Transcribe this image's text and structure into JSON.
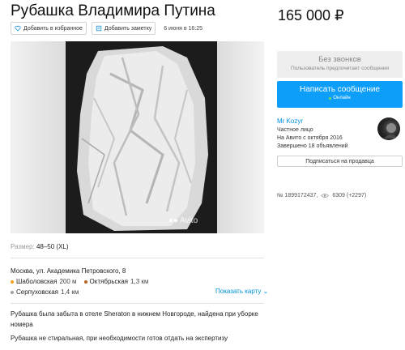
{
  "listing": {
    "title": "Рубашка Владимира Путина",
    "price": "165 000 ₽"
  },
  "actions": {
    "favorite_label": "Добавить в избранное",
    "note_label": "Добавить заметку",
    "posted": "6 июня в 16:25"
  },
  "gallery": {
    "watermark": "Avito"
  },
  "params": {
    "size_label": "Размер:",
    "size_value": "48–50 (XL)"
  },
  "location": {
    "address": "Москва, ул. Академика Петровского, 8",
    "metro": [
      {
        "station": "Шаболовская",
        "distance": "200 м",
        "color": "#f7a21b"
      },
      {
        "station": "Октябрьская",
        "distance": "1,3 км",
        "color": "#b5651d"
      },
      {
        "station": "Серпуховская",
        "distance": "1,4 км",
        "color": "#9aa3a8"
      }
    ],
    "show_map": "Показать карту"
  },
  "description": {
    "lines": [
      "Рубашка была забыта в отеле Sheraton в нижнем Новгороде, найдена при уборке",
      "номера",
      "Рубашка не стиральная, при необходимости готов отдать на экспертизу"
    ]
  },
  "contact": {
    "no_calls_title": "Без звонков",
    "no_calls_sub": "Пользователь предпочитает сообщения",
    "message_button": "Написать сообщение",
    "online": "Онлайн"
  },
  "seller": {
    "name": "Mr Kozyr",
    "type": "Частное лицо",
    "since": "На Авито с октября 2016",
    "completed": "Завершено 18 объявлений",
    "subscribe": "Подписаться на продавца"
  },
  "ad_meta": {
    "number": "№ 1899172437,",
    "views": "6309 (+2297)"
  }
}
